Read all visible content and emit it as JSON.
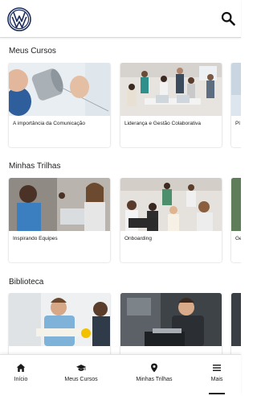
{
  "colors": {
    "brand": "#1a2b5c",
    "text": "#1a1a1a",
    "background": "#ffffff"
  },
  "header": {
    "logo_icon": "vw-logo-icon",
    "search_icon": "search-icon"
  },
  "sections": [
    {
      "title": "Meus Cursos",
      "cards": [
        {
          "label": "A importância da Comunicação"
        },
        {
          "label": "Liderança e Gestão Colaborativa"
        },
        {
          "label": "Pl"
        }
      ]
    },
    {
      "title": "Minhas Trilhas",
      "cards": [
        {
          "label": "Inspirando Equipes"
        },
        {
          "label": "Onboarding"
        },
        {
          "label": "Ge"
        }
      ]
    },
    {
      "title": "Biblioteca",
      "cards": [
        {
          "label": ""
        },
        {
          "label": ""
        },
        {
          "label": ""
        }
      ]
    }
  ],
  "bottom_nav": {
    "items": [
      {
        "label": "Início",
        "icon": "home-icon"
      },
      {
        "label": "Meus Cursos",
        "icon": "graduation-cap-icon"
      },
      {
        "label": "Minhas Trilhas",
        "icon": "map-pin-icon"
      },
      {
        "label": "Mais",
        "icon": "menu-icon"
      }
    ],
    "active": "Mais"
  }
}
